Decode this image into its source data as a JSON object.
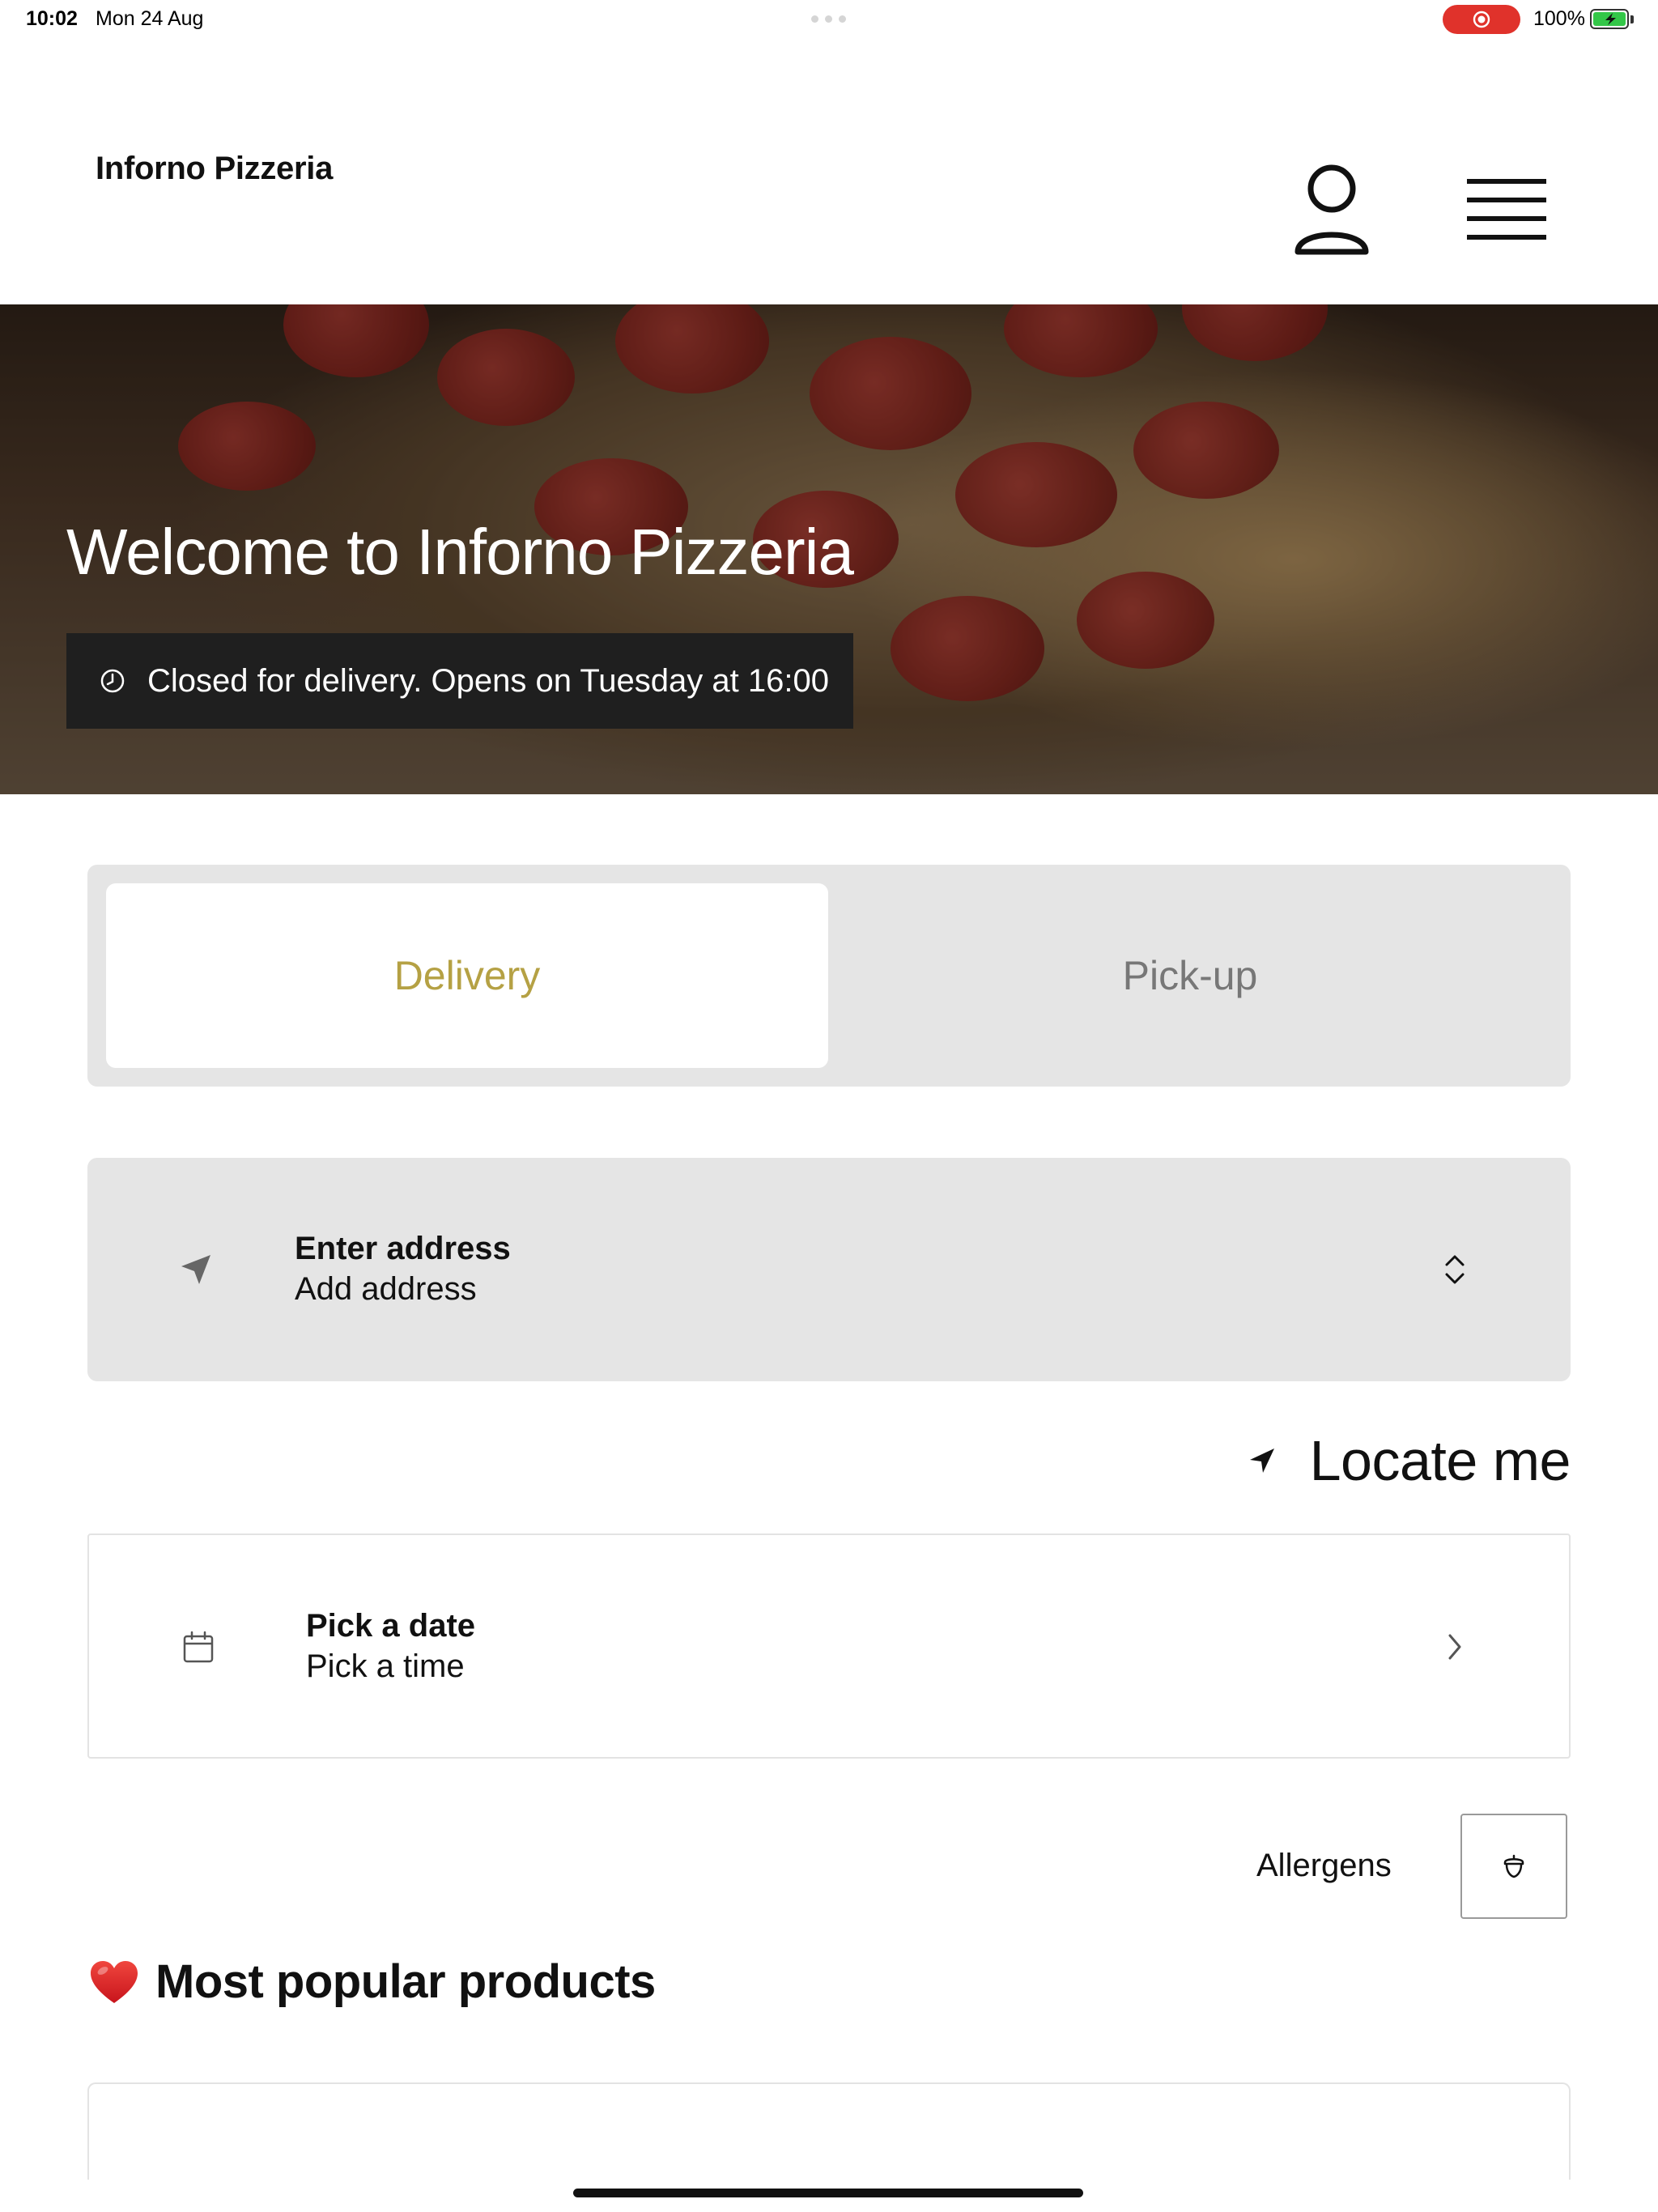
{
  "status_bar": {
    "time": "10:02",
    "date": "Mon 24 Aug",
    "battery": "100%"
  },
  "header": {
    "brand": "Inforno Pizzeria",
    "profile_icon": "person-icon",
    "menu_icon": "hamburger-menu-icon"
  },
  "hero": {
    "title": "Welcome to Inforno Pizzeria",
    "closed_message": "Closed for delivery. Opens on Tuesday at 16:00",
    "clock_icon": "clock-icon"
  },
  "tabs": {
    "delivery_label": "Delivery",
    "pickup_label": "Pick-up",
    "active": "Delivery",
    "active_color": "#b5a144"
  },
  "address": {
    "title": "Enter address",
    "subtitle": "Add address",
    "icon": "navigation-arrow-icon"
  },
  "locate": {
    "label": "Locate me",
    "icon": "location-arrow-icon"
  },
  "schedule": {
    "title": "Pick a date",
    "subtitle": "Pick a time",
    "icon": "calendar-icon"
  },
  "allergens": {
    "label": "Allergens",
    "icon": "acorn-icon"
  },
  "popular": {
    "title": "Most popular products",
    "icon": "heart-icon"
  },
  "colors": {
    "accent": "#b5a144",
    "panel": "#e5e5e5",
    "banner": "#1f1f1f",
    "recording": "#e0322b"
  }
}
